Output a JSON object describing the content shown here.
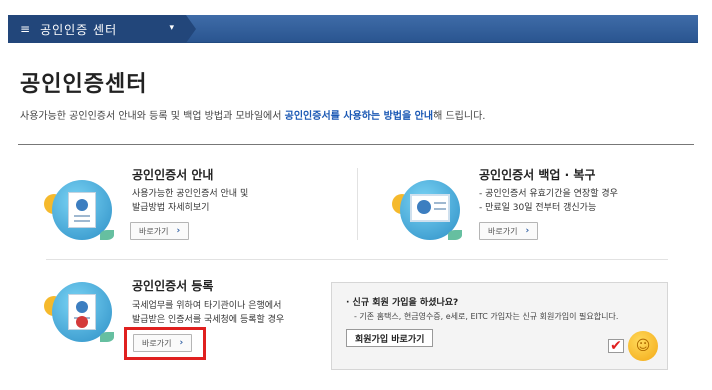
{
  "nav": {
    "menu_icon": "≡",
    "label": "공인인증 센터",
    "caret": "▾"
  },
  "page": {
    "title": "공인인증센터",
    "desc_prefix": "사용가능한 공인인증서 안내와 등록 및 백업 방법과 모바일에서 ",
    "desc_highlight": "공인인증서를 사용하는 방법을 안내",
    "desc_suffix": "해 드립니다."
  },
  "cards": [
    {
      "title": "공인인증서 안내",
      "desc": [
        "사용가능한 공인인증서 안내 및",
        "발급방법 자세히보기"
      ],
      "button": "바로가기",
      "icon": "certificate-document-icon"
    },
    {
      "title": "공인인증서 백업 · 복구",
      "desc": [
        "- 공인인증서 유효기간을 연장할 경우",
        "- 만료일 30일 전부터 갱신가능"
      ],
      "button": "바로가기",
      "icon": "computer-backup-icon"
    },
    {
      "title": "공인인증서 등록",
      "desc": [
        "국세업무를 위하여 타기관이나 은행에서",
        "발급받은 인증서를 국세청에 등록할 경우"
      ],
      "button": "바로가기",
      "icon": "certificate-medal-icon"
    }
  ],
  "notice": {
    "title": "· 신규 회원 가입을 하셨나요?",
    "desc": "- 기존 홈택스, 현금영수증, e세로, EITC 가입자는 신규 회원가입이 필요합니다.",
    "button": "회원가입 바로가기",
    "check": "✔",
    "smiley": "☺"
  },
  "colors": {
    "nav_bar": "#2a5590",
    "highlight_link": "#1a58b4",
    "annotation_red": "#e0201f"
  }
}
